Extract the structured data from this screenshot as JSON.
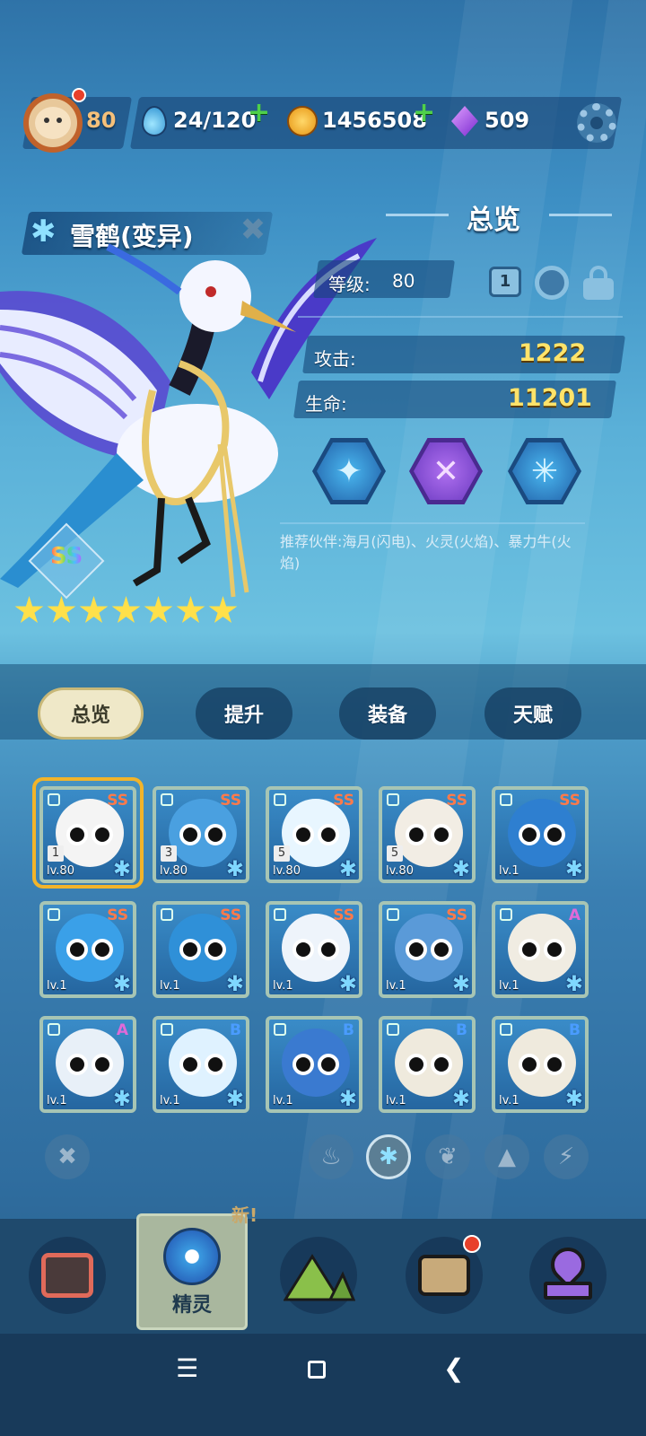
{
  "header": {
    "player_level": "80",
    "stamina": "24/120",
    "coins": "1456508",
    "gems": "509",
    "plus": "+"
  },
  "spirit": {
    "name": "雪鹤(变异)",
    "rank": "SS",
    "star_count": 7
  },
  "overview": {
    "title": "总览",
    "level_label": "等级:",
    "level_value": "80",
    "badge_value": "1",
    "attack_label": "攻击:",
    "attack_value": "1222",
    "hp_label": "生命:",
    "hp_value": "11201",
    "recommend": "推荐伙伴:海月(闪电)、火灵(火焰)、暴力牛(火焰)"
  },
  "tabs": [
    "总览",
    "提升",
    "装备",
    "天赋"
  ],
  "roster": [
    {
      "grade": "SS",
      "level": "lv.80",
      "slot": "1",
      "color": "#f4f4f4",
      "grade_color": "#ff7a4a"
    },
    {
      "grade": "SS",
      "level": "lv.80",
      "slot": "3",
      "color": "#4aa0e0",
      "grade_color": "#ff7a4a"
    },
    {
      "grade": "SS",
      "level": "lv.80",
      "slot": "5",
      "color": "#e8f6ff",
      "grade_color": "#ff7a4a"
    },
    {
      "grade": "SS",
      "level": "lv.80",
      "slot": "5",
      "color": "#f2ede4",
      "grade_color": "#ff7a4a"
    },
    {
      "grade": "SS",
      "level": "lv.1",
      "slot": "",
      "color": "#2e7fd0",
      "grade_color": "#ff7a4a"
    },
    {
      "grade": "SS",
      "level": "lv.1",
      "slot": "",
      "color": "#3aa0e8",
      "grade_color": "#ff7a4a"
    },
    {
      "grade": "SS",
      "level": "lv.1",
      "slot": "",
      "color": "#2f90d8",
      "grade_color": "#ff7a4a"
    },
    {
      "grade": "SS",
      "level": "lv.1",
      "slot": "",
      "color": "#eef4fb",
      "grade_color": "#ff7a4a"
    },
    {
      "grade": "SS",
      "level": "lv.1",
      "slot": "",
      "color": "#5a9ad8",
      "grade_color": "#ff7a4a"
    },
    {
      "grade": "A",
      "level": "lv.1",
      "slot": "",
      "color": "#f0ece2",
      "grade_color": "#e06ad8"
    },
    {
      "grade": "A",
      "level": "lv.1",
      "slot": "",
      "color": "#e8f0f8",
      "grade_color": "#e06ad8"
    },
    {
      "grade": "B",
      "level": "lv.1",
      "slot": "",
      "color": "#dff2ff",
      "grade_color": "#4a9cff"
    },
    {
      "grade": "B",
      "level": "lv.1",
      "slot": "",
      "color": "#3a7ad0",
      "grade_color": "#4a9cff"
    },
    {
      "grade": "B",
      "level": "lv.1",
      "slot": "",
      "color": "#efeadd",
      "grade_color": "#4a9cff"
    },
    {
      "grade": "B",
      "level": "lv.1",
      "slot": "",
      "color": "#efeadd",
      "grade_color": "#4a9cff"
    }
  ],
  "filters": [
    "clear-icon",
    "fire-icon",
    "ice-icon",
    "leaf-icon",
    "rock-icon",
    "lightning-icon"
  ],
  "nav": {
    "active_label": "精灵",
    "new_tag": "新!"
  },
  "colors": {
    "accent_gold": "#ffe36a",
    "active_tab": "#efe8c8",
    "ice_blue": "#8fe0ff"
  }
}
